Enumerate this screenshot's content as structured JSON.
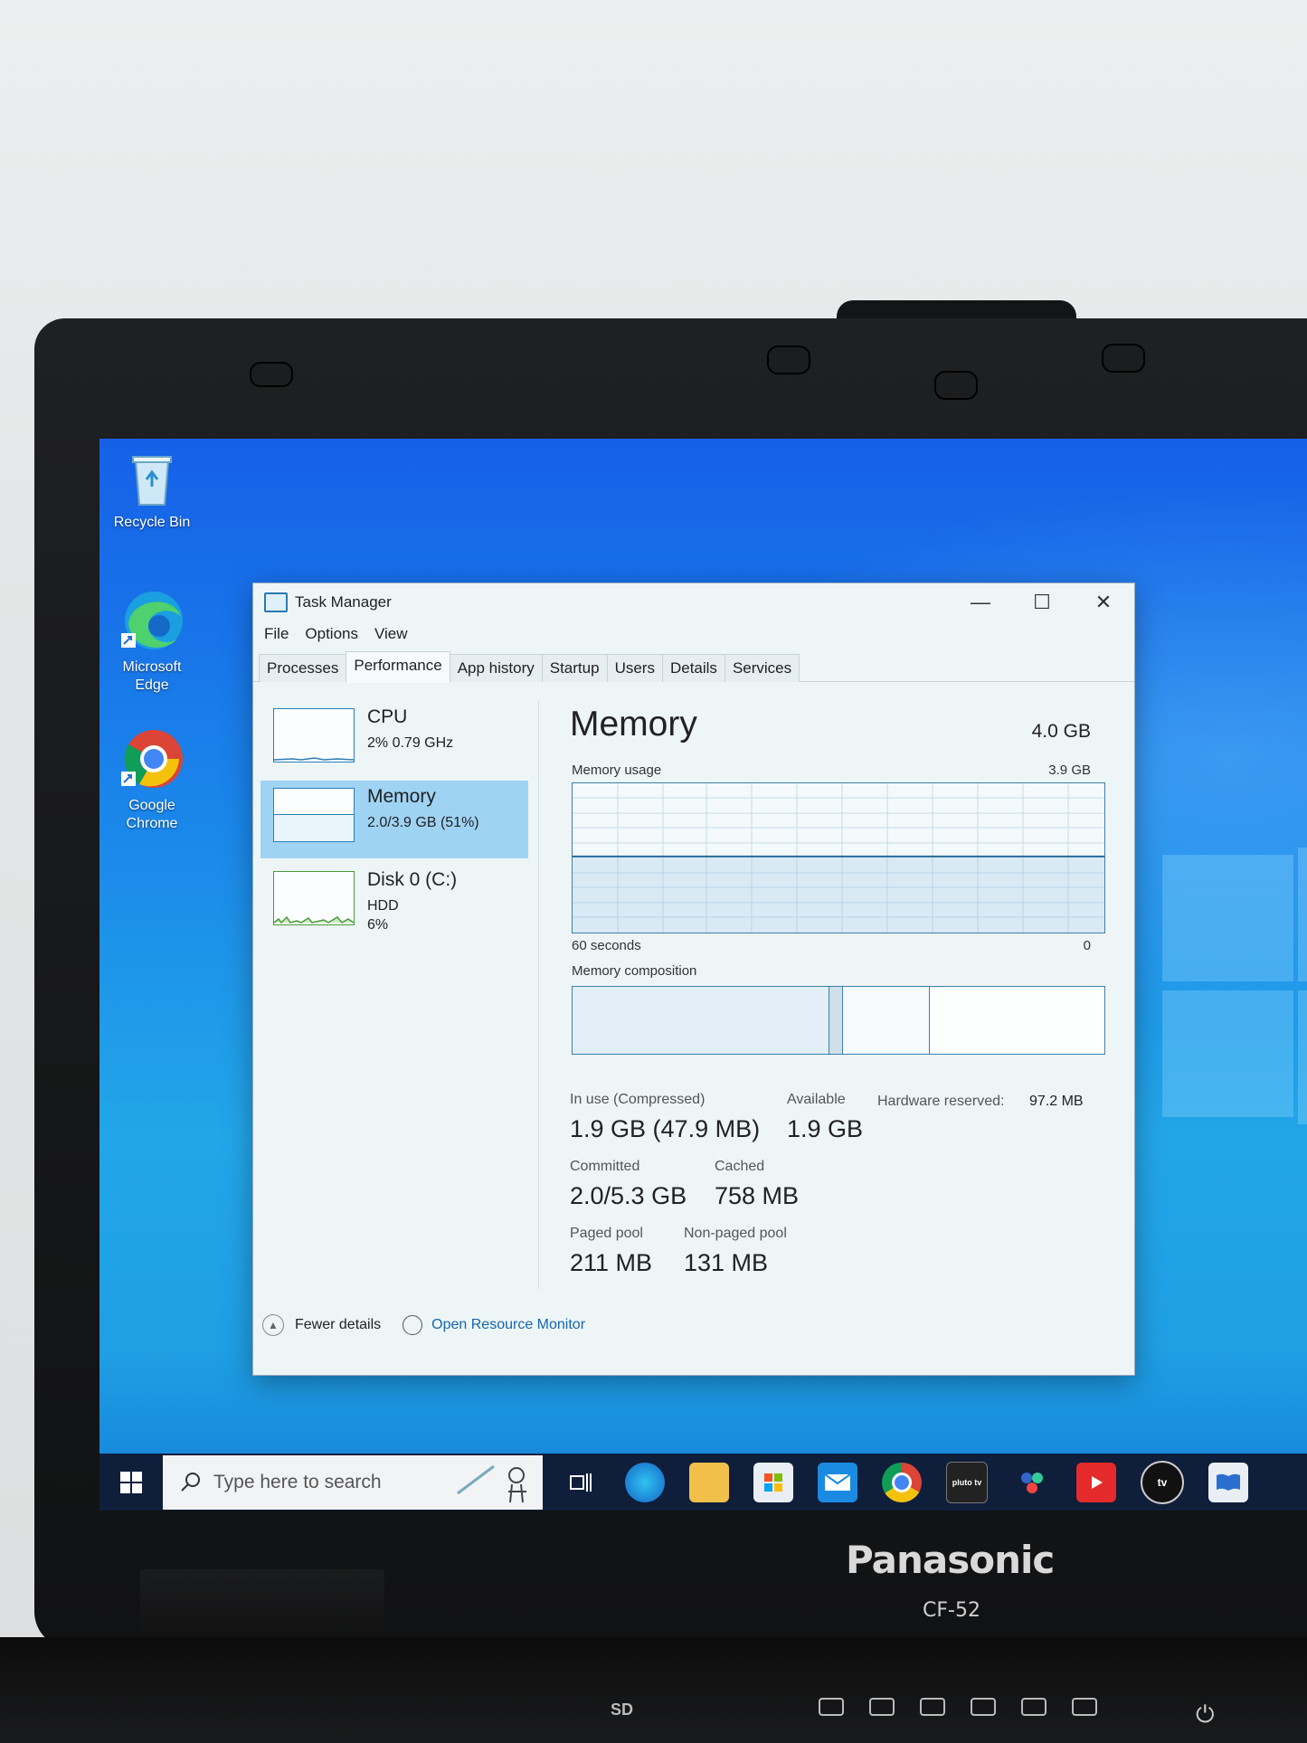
{
  "desktop": {
    "icons": [
      {
        "label_line1": "Recycle Bin",
        "label_line2": ""
      },
      {
        "label_line1": "Microsoft",
        "label_line2": "Edge"
      },
      {
        "label_line1": "Google",
        "label_line2": "Chrome"
      }
    ]
  },
  "window": {
    "title": "Task Manager",
    "controls": {
      "minimize": "—",
      "maximize": "☐",
      "close": "✕"
    },
    "menu": [
      "File",
      "Options",
      "View"
    ],
    "tabs": [
      "Processes",
      "Performance",
      "App history",
      "Startup",
      "Users",
      "Details",
      "Services"
    ],
    "active_tab": "Performance"
  },
  "sidebar": {
    "items": [
      {
        "name": "CPU",
        "line1": "2%  0.79 GHz",
        "line2": "",
        "selected": false
      },
      {
        "name": "Memory",
        "line1": "2.0/3.9 GB (51%)",
        "line2": "",
        "selected": true
      },
      {
        "name": "Disk 0 (C:)",
        "line1": "HDD",
        "line2": "6%",
        "selected": false
      }
    ]
  },
  "memory": {
    "title": "Memory",
    "total": "4.0 GB",
    "usage_label": "Memory usage",
    "usage_max": "3.9 GB",
    "usage_fraction": 0.51,
    "x_left": "60 seconds",
    "x_right": "0",
    "composition_label": "Memory composition",
    "stats": {
      "in_use_label": "In use (Compressed)",
      "in_use_value": "1.9 GB (47.9 MB)",
      "available_label": "Available",
      "available_value": "1.9 GB",
      "hw_reserved_label": "Hardware reserved:",
      "hw_reserved_value": "97.2 MB",
      "committed_label": "Committed",
      "committed_value": "2.0/5.3 GB",
      "cached_label": "Cached",
      "cached_value": "758 MB",
      "paged_label": "Paged pool",
      "paged_value": "211 MB",
      "nonpaged_label": "Non-paged pool",
      "nonpaged_value": "131 MB"
    }
  },
  "footer": {
    "fewer_details": "Fewer details",
    "open_resource_monitor": "Open Resource Monitor"
  },
  "taskbar": {
    "search_placeholder": "Type here to search",
    "store_badge": "pluto tv",
    "tv_badge": "tv"
  },
  "device": {
    "brand": "Panasonic",
    "model": "CF-52",
    "sd_label": "SD"
  },
  "colors": {
    "accent": "#1467b0",
    "selected_item": "#9fd3f4",
    "graph_border": "#3f7fa8"
  }
}
